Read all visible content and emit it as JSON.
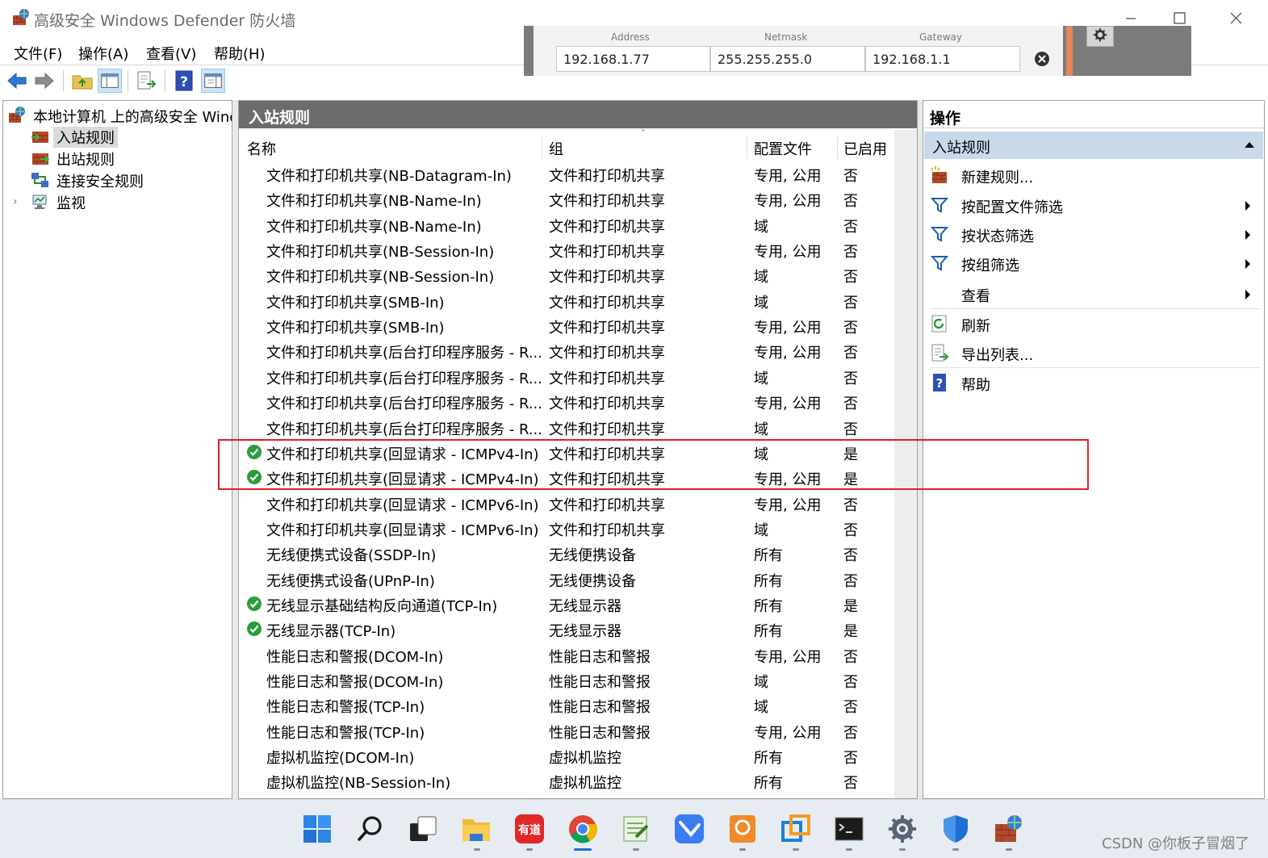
{
  "window": {
    "title": "高级安全 Windows Defender 防火墙"
  },
  "menu": [
    "文件(F)",
    "操作(A)",
    "查看(V)",
    "帮助(H)"
  ],
  "network_widget": {
    "labels": {
      "address": "Address",
      "netmask": "Netmask",
      "gateway": "Gateway"
    },
    "values": {
      "address": "192.168.1.77",
      "netmask": "255.255.255.0",
      "gateway": "192.168.1.1"
    }
  },
  "tree": {
    "root": "本地计算机 上的高级安全 Windows Defender 防火墙",
    "items": [
      "入站规则",
      "出站规则",
      "连接安全规则",
      "监视"
    ]
  },
  "center": {
    "header": "入站规则",
    "columns": {
      "name": "名称",
      "group": "组",
      "profile": "配置文件",
      "enabled": "已启用"
    },
    "rows": [
      {
        "name": "文件和打印机共享(NB-Datagram-In)",
        "group": "文件和打印机共享",
        "profile": "专用, 公用",
        "enabled": "否",
        "check": false
      },
      {
        "name": "文件和打印机共享(NB-Name-In)",
        "group": "文件和打印机共享",
        "profile": "专用, 公用",
        "enabled": "否",
        "check": false
      },
      {
        "name": "文件和打印机共享(NB-Name-In)",
        "group": "文件和打印机共享",
        "profile": "域",
        "enabled": "否",
        "check": false
      },
      {
        "name": "文件和打印机共享(NB-Session-In)",
        "group": "文件和打印机共享",
        "profile": "专用, 公用",
        "enabled": "否",
        "check": false
      },
      {
        "name": "文件和打印机共享(NB-Session-In)",
        "group": "文件和打印机共享",
        "profile": "域",
        "enabled": "否",
        "check": false
      },
      {
        "name": "文件和打印机共享(SMB-In)",
        "group": "文件和打印机共享",
        "profile": "域",
        "enabled": "否",
        "check": false
      },
      {
        "name": "文件和打印机共享(SMB-In)",
        "group": "文件和打印机共享",
        "profile": "专用, 公用",
        "enabled": "否",
        "check": false
      },
      {
        "name": "文件和打印机共享(后台打印程序服务 - R...",
        "group": "文件和打印机共享",
        "profile": "专用, 公用",
        "enabled": "否",
        "check": false
      },
      {
        "name": "文件和打印机共享(后台打印程序服务 - R...",
        "group": "文件和打印机共享",
        "profile": "域",
        "enabled": "否",
        "check": false
      },
      {
        "name": "文件和打印机共享(后台打印程序服务 - R...",
        "group": "文件和打印机共享",
        "profile": "专用, 公用",
        "enabled": "否",
        "check": false
      },
      {
        "name": "文件和打印机共享(后台打印程序服务 - R...",
        "group": "文件和打印机共享",
        "profile": "域",
        "enabled": "否",
        "check": false
      },
      {
        "name": "文件和打印机共享(回显请求 - ICMPv4-In)",
        "group": "文件和打印机共享",
        "profile": "域",
        "enabled": "是",
        "check": true
      },
      {
        "name": "文件和打印机共享(回显请求 - ICMPv4-In)",
        "group": "文件和打印机共享",
        "profile": "专用, 公用",
        "enabled": "是",
        "check": true
      },
      {
        "name": "文件和打印机共享(回显请求 - ICMPv6-In)",
        "group": "文件和打印机共享",
        "profile": "专用, 公用",
        "enabled": "否",
        "check": false
      },
      {
        "name": "文件和打印机共享(回显请求 - ICMPv6-In)",
        "group": "文件和打印机共享",
        "profile": "域",
        "enabled": "否",
        "check": false
      },
      {
        "name": "无线便携式设备(SSDP-In)",
        "group": "无线便携设备",
        "profile": "所有",
        "enabled": "否",
        "check": false
      },
      {
        "name": "无线便携式设备(UPnP-In)",
        "group": "无线便携设备",
        "profile": "所有",
        "enabled": "否",
        "check": false
      },
      {
        "name": "无线显示基础结构反向通道(TCP-In)",
        "group": "无线显示器",
        "profile": "所有",
        "enabled": "是",
        "check": true
      },
      {
        "name": "无线显示器(TCP-In)",
        "group": "无线显示器",
        "profile": "所有",
        "enabled": "是",
        "check": true
      },
      {
        "name": "性能日志和警报(DCOM-In)",
        "group": "性能日志和警报",
        "profile": "专用, 公用",
        "enabled": "否",
        "check": false
      },
      {
        "name": "性能日志和警报(DCOM-In)",
        "group": "性能日志和警报",
        "profile": "域",
        "enabled": "否",
        "check": false
      },
      {
        "name": "性能日志和警报(TCP-In)",
        "group": "性能日志和警报",
        "profile": "域",
        "enabled": "否",
        "check": false
      },
      {
        "name": "性能日志和警报(TCP-In)",
        "group": "性能日志和警报",
        "profile": "专用, 公用",
        "enabled": "否",
        "check": false
      },
      {
        "name": "虚拟机监控(DCOM-In)",
        "group": "虚拟机监控",
        "profile": "所有",
        "enabled": "否",
        "check": false
      },
      {
        "name": "虚拟机监控(NB-Session-In)",
        "group": "虚拟机监控",
        "profile": "所有",
        "enabled": "否",
        "check": false
      }
    ]
  },
  "actions": {
    "header": "操作",
    "section": "入站规则",
    "items": [
      {
        "label": "新建规则...",
        "icon": "new-rule-icon",
        "submenu": false
      },
      {
        "label": "按配置文件筛选",
        "icon": "filter-icon",
        "submenu": true
      },
      {
        "label": "按状态筛选",
        "icon": "filter-icon",
        "submenu": true
      },
      {
        "label": "按组筛选",
        "icon": "filter-icon",
        "submenu": true
      },
      {
        "label": "查看",
        "icon": "",
        "submenu": true
      },
      {
        "label": "刷新",
        "icon": "refresh-icon",
        "submenu": false
      },
      {
        "label": "导出列表...",
        "icon": "export-list-icon",
        "submenu": false
      },
      {
        "label": "帮助",
        "icon": "help-icon",
        "submenu": false
      }
    ]
  },
  "taskbar": {
    "apps": [
      "start-icon",
      "search-icon",
      "task-view-icon",
      "file-explorer-icon",
      "youdao-icon",
      "chrome-icon",
      "notepad-icon",
      "feishu-icon",
      "pdf-icon",
      "virtualbox-icon",
      "terminal-icon",
      "settings-icon",
      "defender-icon",
      "firewall-icon"
    ]
  },
  "watermark": "CSDN @你板子冒烟了",
  "colors": {
    "center_header_bg": "#6c6c6c",
    "action_section_bg": "#c9d9ea",
    "highlight_border": "#e02020",
    "check_green": "#2a9d3a"
  }
}
